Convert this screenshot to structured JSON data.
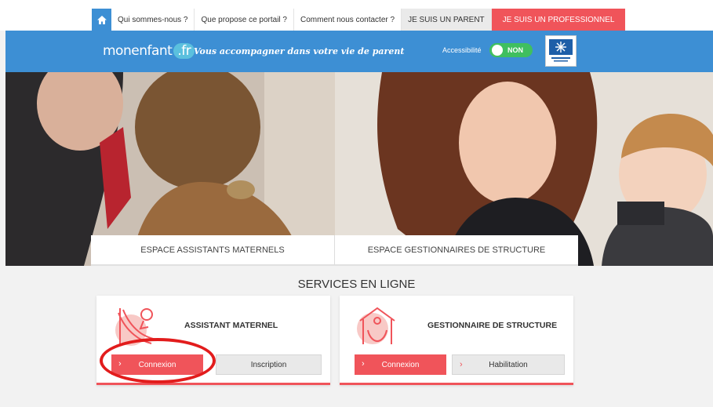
{
  "topnav": {
    "home_icon": "home-icon",
    "items": [
      {
        "label": "Qui sommes-nous ?"
      },
      {
        "label": "Que propose ce portail ?"
      },
      {
        "label": "Comment nous contacter ?"
      },
      {
        "label": "JE SUIS UN PARENT"
      },
      {
        "label": "JE SUIS UN PROFESSIONNEL"
      }
    ]
  },
  "header": {
    "logo_text": "monenfant",
    "logo_suffix": ".fr",
    "tagline": "Vous accompagner dans votre vie de parent",
    "accessibility_label": "Accessibilité",
    "accessibility_toggle": "NON",
    "partner_logo": "caf-logo"
  },
  "spaces": [
    {
      "label": "ESPACE ASSISTANTS MATERNELS"
    },
    {
      "label": "ESPACE GESTIONNAIRES DE STRUCTURE"
    }
  ],
  "services": {
    "title": "SERVICES EN LIGNE",
    "cards": [
      {
        "title": "ASSISTANT MATERNEL",
        "icon": "slide-child-icon",
        "primary": "Connexion",
        "secondary": "Inscription"
      },
      {
        "title": "GESTIONNAIRE DE STRUCTURE",
        "icon": "house-hands-icon",
        "primary": "Connexion",
        "secondary": "Habilitation"
      }
    ]
  },
  "colors": {
    "accent": "#f0545a",
    "brand_blue": "#3d8fd4",
    "toggle_green": "#3fbf5f",
    "highlight": "#e21c1c"
  }
}
